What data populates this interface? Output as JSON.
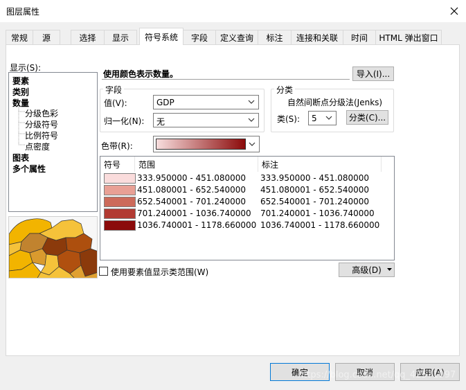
{
  "window": {
    "title": "图层属性"
  },
  "tabs": [
    {
      "label": "常规"
    },
    {
      "label": "源"
    },
    {
      "label": "选择"
    },
    {
      "label": "显示"
    },
    {
      "label": "符号系统"
    },
    {
      "label": "字段"
    },
    {
      "label": "定义查询"
    },
    {
      "label": "标注"
    },
    {
      "label": "连接和关联"
    },
    {
      "label": "时间"
    },
    {
      "label": "HTML 弹出窗口"
    }
  ],
  "show_panel": {
    "label": "显示(S):",
    "items": [
      {
        "label": "要素",
        "kind": "category"
      },
      {
        "label": "类别",
        "kind": "category"
      },
      {
        "label": "数量",
        "kind": "category"
      },
      {
        "label": "分级色彩",
        "kind": "sub"
      },
      {
        "label": "分级符号",
        "kind": "sub"
      },
      {
        "label": "比例符号",
        "kind": "sub"
      },
      {
        "label": "点密度",
        "kind": "sub"
      },
      {
        "label": "图表",
        "kind": "category"
      },
      {
        "label": "多个属性",
        "kind": "category"
      }
    ]
  },
  "heading": "使用颜色表示数量。",
  "import_button": "导入(I)...",
  "field_group": {
    "title": "字段",
    "value_label": "值(V):",
    "value": "GDP",
    "normalize_label": "归一化(N):",
    "normalize": "无"
  },
  "classify_group": {
    "title": "分类",
    "method": "自然间断点分级法(Jenks)",
    "classes_label": "类(S):",
    "classes": "5",
    "classify_button": "分类(C)..."
  },
  "color_ramp_label": "色带(R):",
  "colors": {
    "ramp_start": "#f8dede",
    "ramp_end": "#8b0a0a",
    "accent": "#0078d7"
  },
  "table": {
    "headers": {
      "symbol": "符号",
      "range": "范围",
      "label": "标注"
    },
    "rows": [
      {
        "color": "#fadcdc",
        "range": "333.950000 - 451.080000",
        "label": "333.950000 - 451.080000"
      },
      {
        "color": "#e8a095",
        "range": "451.080001 - 652.540000",
        "label": "451.080001 - 652.540000"
      },
      {
        "color": "#cc6a5a",
        "range": "652.540001 - 701.240000",
        "label": "652.540001 - 701.240000"
      },
      {
        "color": "#b23a32",
        "range": "701.240001 - 1036.740000",
        "label": "701.240001 - 1036.740000"
      },
      {
        "color": "#8b0b0b",
        "range": "1036.740001 - 1178.660000",
        "label": "1036.740001 - 1178.660000"
      }
    ]
  },
  "checkbox_label": "使用要素值显示类范围(W)",
  "advanced_button": "高级(D)",
  "footer": {
    "ok": "确定",
    "cancel": "取消",
    "apply": "应用(A)",
    "watermark": "https://blog.csdn.net/qq_42571997"
  }
}
